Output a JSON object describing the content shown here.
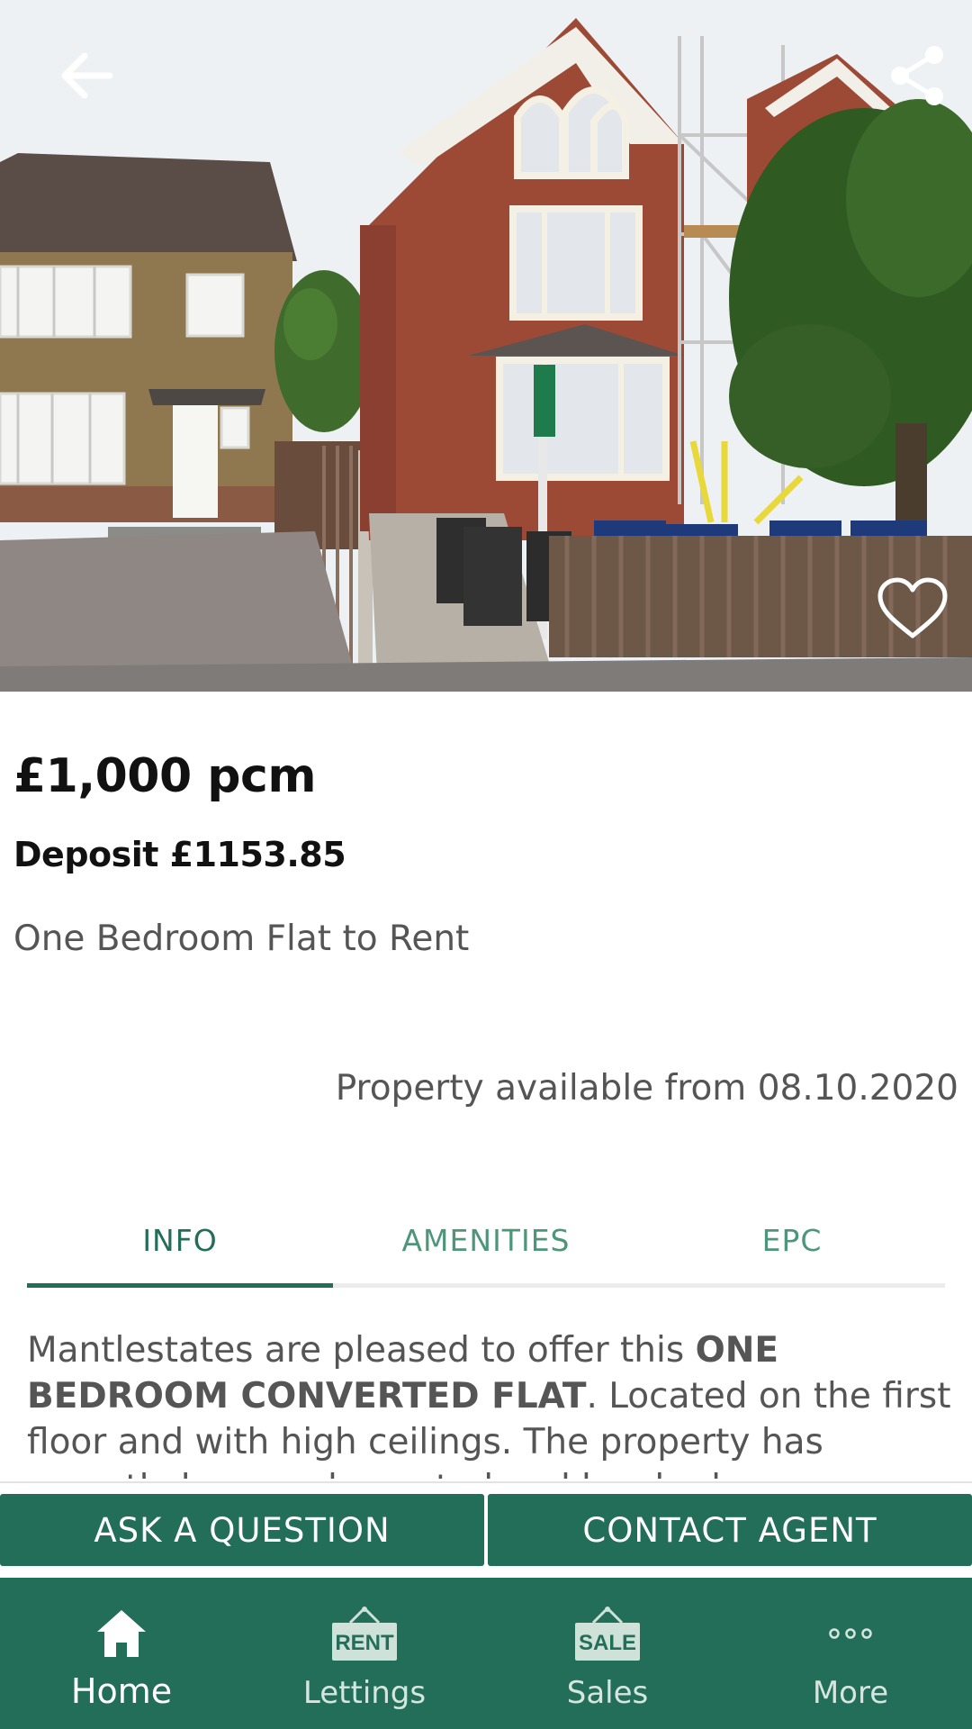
{
  "hero": {
    "back_icon": "arrow-left-icon",
    "share_icon": "share-icon",
    "favourite_icon": "heart-outline-icon"
  },
  "listing": {
    "price": "£1,000 pcm",
    "deposit": "Deposit £1153.85",
    "property_type": "One Bedroom Flat to Rent",
    "availability": "Property available from 08.10.2020"
  },
  "tabs": [
    {
      "label": "INFO",
      "active": true
    },
    {
      "label": "AMENITIES",
      "active": false
    },
    {
      "label": "EPC",
      "active": false
    }
  ],
  "description": {
    "intro": "Mantlestates are pleased to offer this ",
    "highlight": "ONE BEDROOM CONVERTED FLAT",
    "rest": ". Located on the first floor and with high ceilings. The property has recently been redecorated and has had new"
  },
  "actions": {
    "ask": "ASK A QUESTION",
    "contact": "CONTACT AGENT"
  },
  "nav": {
    "items": [
      {
        "label": "Home",
        "icon": "home-icon",
        "active": true
      },
      {
        "label": "Lettings",
        "icon": "rent-sign-icon",
        "badge": "RENT"
      },
      {
        "label": "Sales",
        "icon": "sale-sign-icon",
        "badge": "SALE"
      },
      {
        "label": "More",
        "icon": "more-dots-icon"
      }
    ]
  },
  "colors": {
    "brand_green": "#236e58",
    "tab_text": "#4d9679"
  }
}
